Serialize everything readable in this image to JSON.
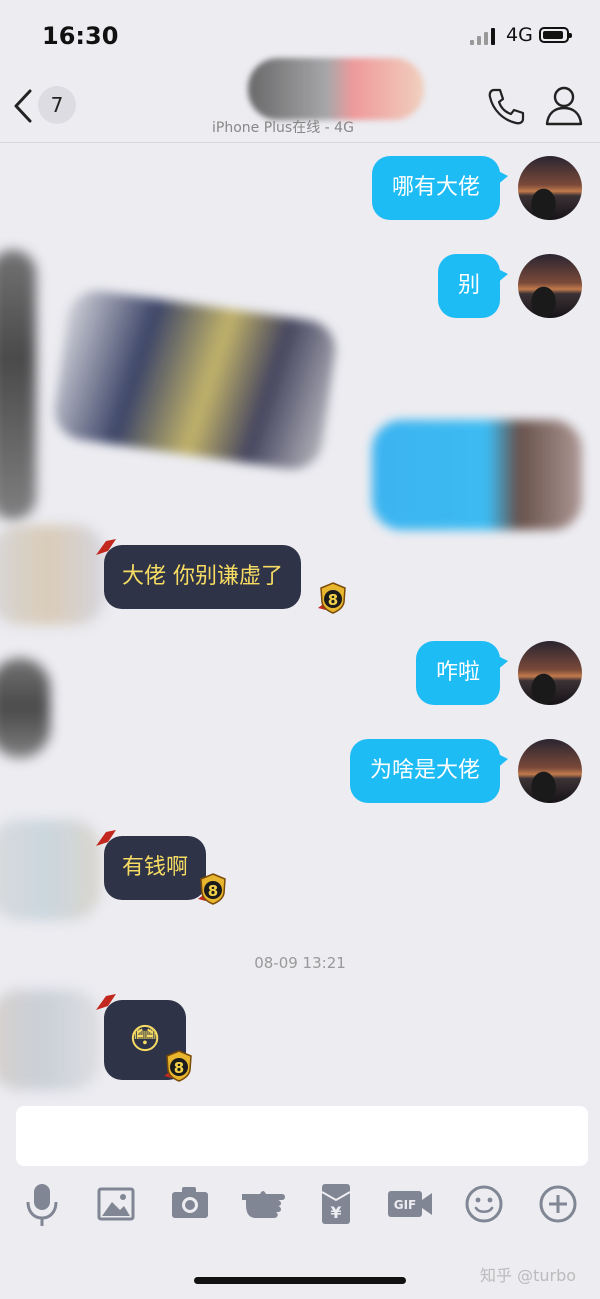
{
  "status": {
    "time": "16:30",
    "network": "4G"
  },
  "nav": {
    "unread_count": "7",
    "subtitle": "iPhone Plus在线 - 4G"
  },
  "messages": [
    {
      "text": "哪有大佬"
    },
    {
      "text": "别"
    },
    {
      "text": "大佬  你别谦虚了"
    },
    {
      "text": "咋啦"
    },
    {
      "text": "为啥是大佬"
    },
    {
      "text": "有钱啊"
    }
  ],
  "timestamp": "08-09 13:21",
  "last_message_emoji": "😳",
  "deco_badge": "8",
  "input": {
    "placeholder": ""
  },
  "toolbar_icons": [
    "microphone-icon",
    "image-icon",
    "camera-icon",
    "poke-hand-icon",
    "red-packet-icon",
    "gif-icon",
    "emoji-icon",
    "plus-icon"
  ],
  "red_packet_symbol": "¥",
  "gif_label": "GIF",
  "watermark": "知乎 @turbo",
  "colors": {
    "outgoing_bubble": "#1ebcf5",
    "incoming_bubble": "#2f3348",
    "incoming_text": "#f6dc62"
  }
}
